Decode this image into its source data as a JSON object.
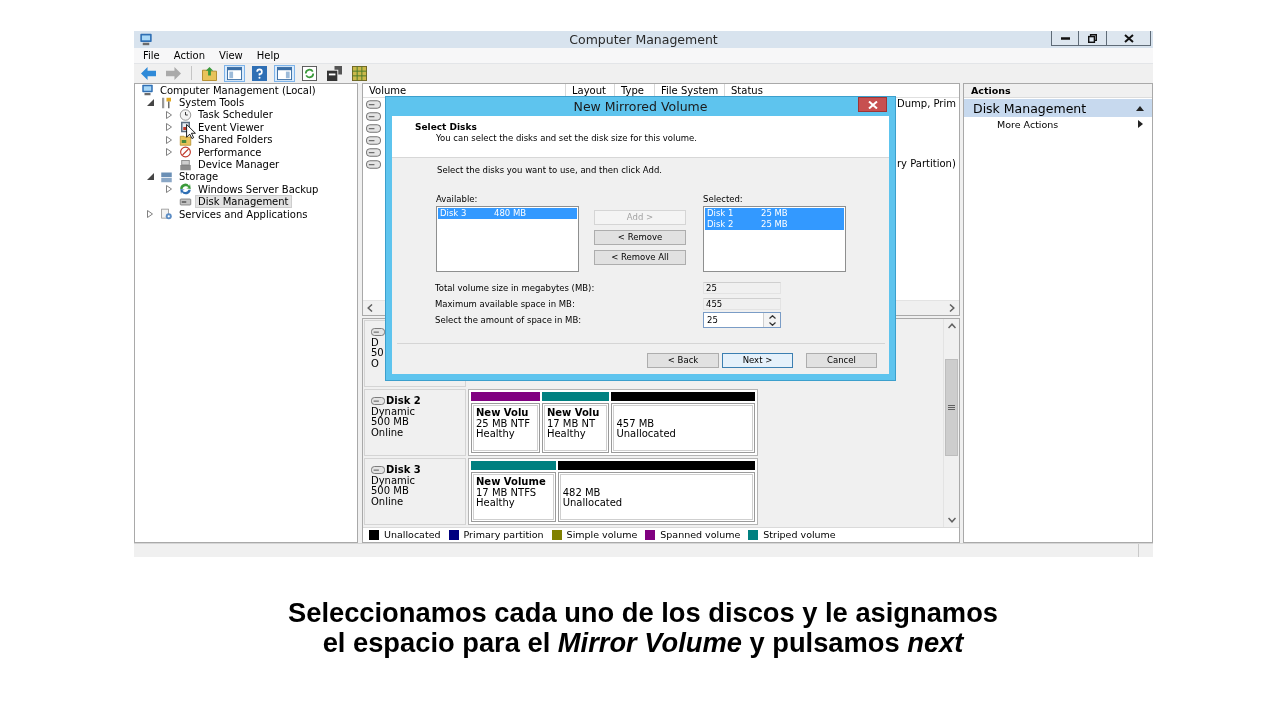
{
  "window": {
    "title": "Computer Management",
    "menu": [
      "File",
      "Action",
      "View",
      "Help"
    ]
  },
  "toolbar": {
    "groups": [
      [
        {
          "pressed": false,
          "disabled": false
        },
        {
          "pressed": false,
          "disabled": true
        }
      ],
      [
        {
          "pressed": false,
          "disabled": false
        },
        {
          "pressed": true,
          "disabled": false
        },
        {
          "pressed": false,
          "disabled": false
        },
        {
          "pressed": true,
          "disabled": false
        },
        {
          "pressed": false,
          "disabled": false
        },
        {
          "pressed": false,
          "disabled": false
        },
        {
          "pressed": false,
          "disabled": false
        }
      ]
    ]
  },
  "tree": {
    "items": [
      {
        "label": "Computer Management (Local)",
        "selected": false,
        "children": [
          {
            "label": "System Tools",
            "expanded": true,
            "selected": false,
            "children": [
              {
                "label": "Task Scheduler",
                "expanded": false,
                "selected": false
              },
              {
                "label": "Event Viewer",
                "expanded": false,
                "selected": false
              },
              {
                "label": "Shared Folders",
                "expanded": false,
                "selected": false
              },
              {
                "label": "Performance",
                "expanded": false,
                "selected": false
              },
              {
                "label": "Device Manager",
                "selected": false
              }
            ]
          },
          {
            "label": "Storage",
            "expanded": true,
            "selected": false,
            "children": [
              {
                "label": "Windows Server Backup",
                "expanded": false,
                "selected": false
              },
              {
                "label": "Disk Management",
                "selected": true
              }
            ]
          },
          {
            "label": "Services and Applications",
            "expanded": false,
            "selected": false
          }
        ]
      }
    ]
  },
  "volume_list": {
    "columns": [
      "Volume",
      "Layout",
      "Type",
      "File System",
      "Status"
    ],
    "rows": [
      {
        "kind": "volume",
        "status": "Dump, Prim"
      },
      {
        "kind": "volume"
      },
      {
        "kind": "volume"
      },
      {
        "kind": "volume"
      },
      {
        "kind": "volume"
      },
      {
        "kind": "volume",
        "status": "ry Partition)"
      }
    ]
  },
  "disks": [
    {
      "lines": [
        "D",
        "50",
        "O"
      ]
    },
    {
      "name": "Disk 2",
      "lines": [
        "Dynamic",
        "500 MB",
        "Online"
      ],
      "volumes": [
        {
          "color": "#800080",
          "title": "New Volu",
          "lines": [
            "25 MB NTF",
            "Healthy"
          ]
        },
        {
          "color": "#008080",
          "title": "New Volu",
          "lines": [
            "17 MB NT",
            "Healthy"
          ]
        },
        {
          "color": "#000000",
          "lines": [
            "457 MB",
            "Unallocated"
          ]
        }
      ]
    },
    {
      "name": "Disk 3",
      "lines": [
        "Dynamic",
        "500 MB",
        "Online"
      ],
      "volumes": [
        {
          "color": "#008080",
          "title": "New Volume",
          "lines": [
            "17 MB NTFS",
            "Healthy"
          ]
        },
        {
          "color": "#000000",
          "lines": [
            "482 MB",
            "Unallocated"
          ]
        }
      ]
    }
  ],
  "legend": [
    {
      "label": "Unallocated",
      "color": "#000000"
    },
    {
      "label": "Primary partition",
      "color": "#000080"
    },
    {
      "label": "Simple volume",
      "color": "#808000"
    },
    {
      "label": "Spanned volume",
      "color": "#800080"
    },
    {
      "label": "Striped volume",
      "color": "#008080"
    }
  ],
  "actions": {
    "title": "Actions",
    "items": [
      {
        "label": "Disk Management",
        "kind": "section"
      },
      {
        "label": "More Actions",
        "kind": "submenu"
      }
    ]
  },
  "dialog": {
    "title": "New Mirrored Volume",
    "heading": "Select Disks",
    "subheading": "You can select the disks and set the disk size for this volume.",
    "instruction": "Select the disks you want to use, and then click Add.",
    "available_list": {
      "label": "Available:",
      "items": [
        {
          "disk": "Disk 3",
          "size": "480 MB",
          "selected": true
        }
      ]
    },
    "move_buttons": [
      {
        "label": "Add >",
        "disabled": true
      },
      {
        "label": "< Remove",
        "disabled": false
      },
      {
        "label": "< Remove All",
        "disabled": false
      }
    ],
    "selected_list": {
      "label": "Selected:",
      "items": [
        {
          "disk": "Disk 1",
          "size": "25 MB",
          "selected": true
        },
        {
          "disk": "Disk 2",
          "size": "25 MB",
          "selected": true
        }
      ]
    },
    "fields": [
      {
        "label": "Total volume size in megabytes (MB):",
        "value": "25",
        "kind": "readonly"
      },
      {
        "label": "Maximum available space in MB:",
        "value": "455",
        "kind": "readonly"
      },
      {
        "label": "Select the amount of space in MB:",
        "value": "25",
        "kind": "spin"
      }
    ],
    "buttons": [
      {
        "label": "< Back",
        "default": false
      },
      {
        "label": "Next >",
        "default": true
      },
      {
        "label": "Cancel",
        "default": false
      }
    ]
  },
  "caption": "Seleccionamos cada uno de los discos y le asignamos el espacio para el *Mirror Volume* y pulsamos *next*"
}
